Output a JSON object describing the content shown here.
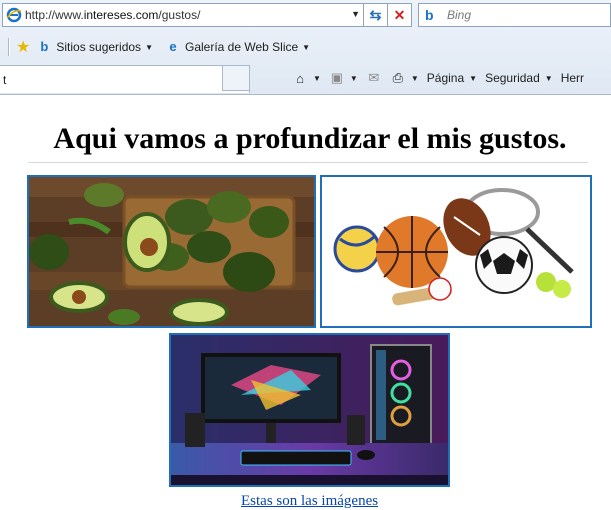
{
  "browser": {
    "address": {
      "url_prefix": "http://www.",
      "url_domain": "intereses.com",
      "url_path": "/gustos/"
    },
    "search": {
      "placeholder": "Bing"
    },
    "favorites": {
      "items": [
        {
          "label": "Sitios sugeridos"
        },
        {
          "label": "Galería de Web Slice"
        }
      ]
    },
    "tab": {
      "label": "t"
    },
    "commands": {
      "page_label": "Página",
      "security_label": "Seguridad",
      "tools_label": "Herr"
    }
  },
  "page": {
    "title": "Aqui vamos a profundizar el mis gustos.",
    "images": [
      {
        "name": "avocado-image"
      },
      {
        "name": "sports-balls-image"
      },
      {
        "name": "gaming-setup-image"
      }
    ],
    "link_text": "Estas son las imágenes"
  }
}
